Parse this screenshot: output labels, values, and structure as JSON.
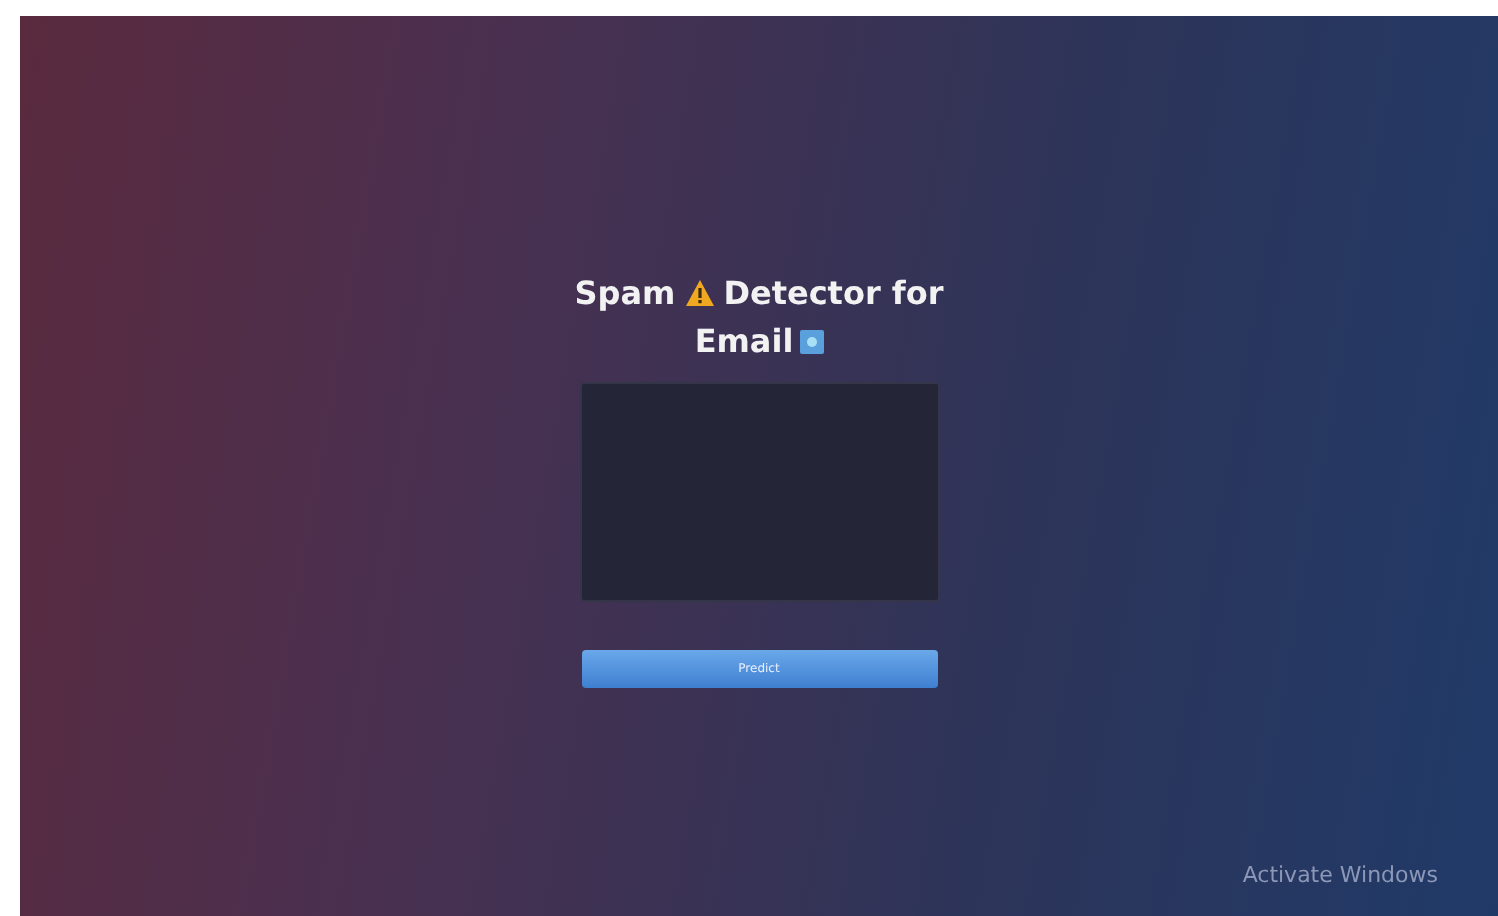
{
  "heading": {
    "before_icon": "Spam",
    "after_icon": "Detector for",
    "second_line": "Email"
  },
  "predict_button": {
    "label": "Predict"
  },
  "os_notice": {
    "text": "Activate Windows"
  }
}
